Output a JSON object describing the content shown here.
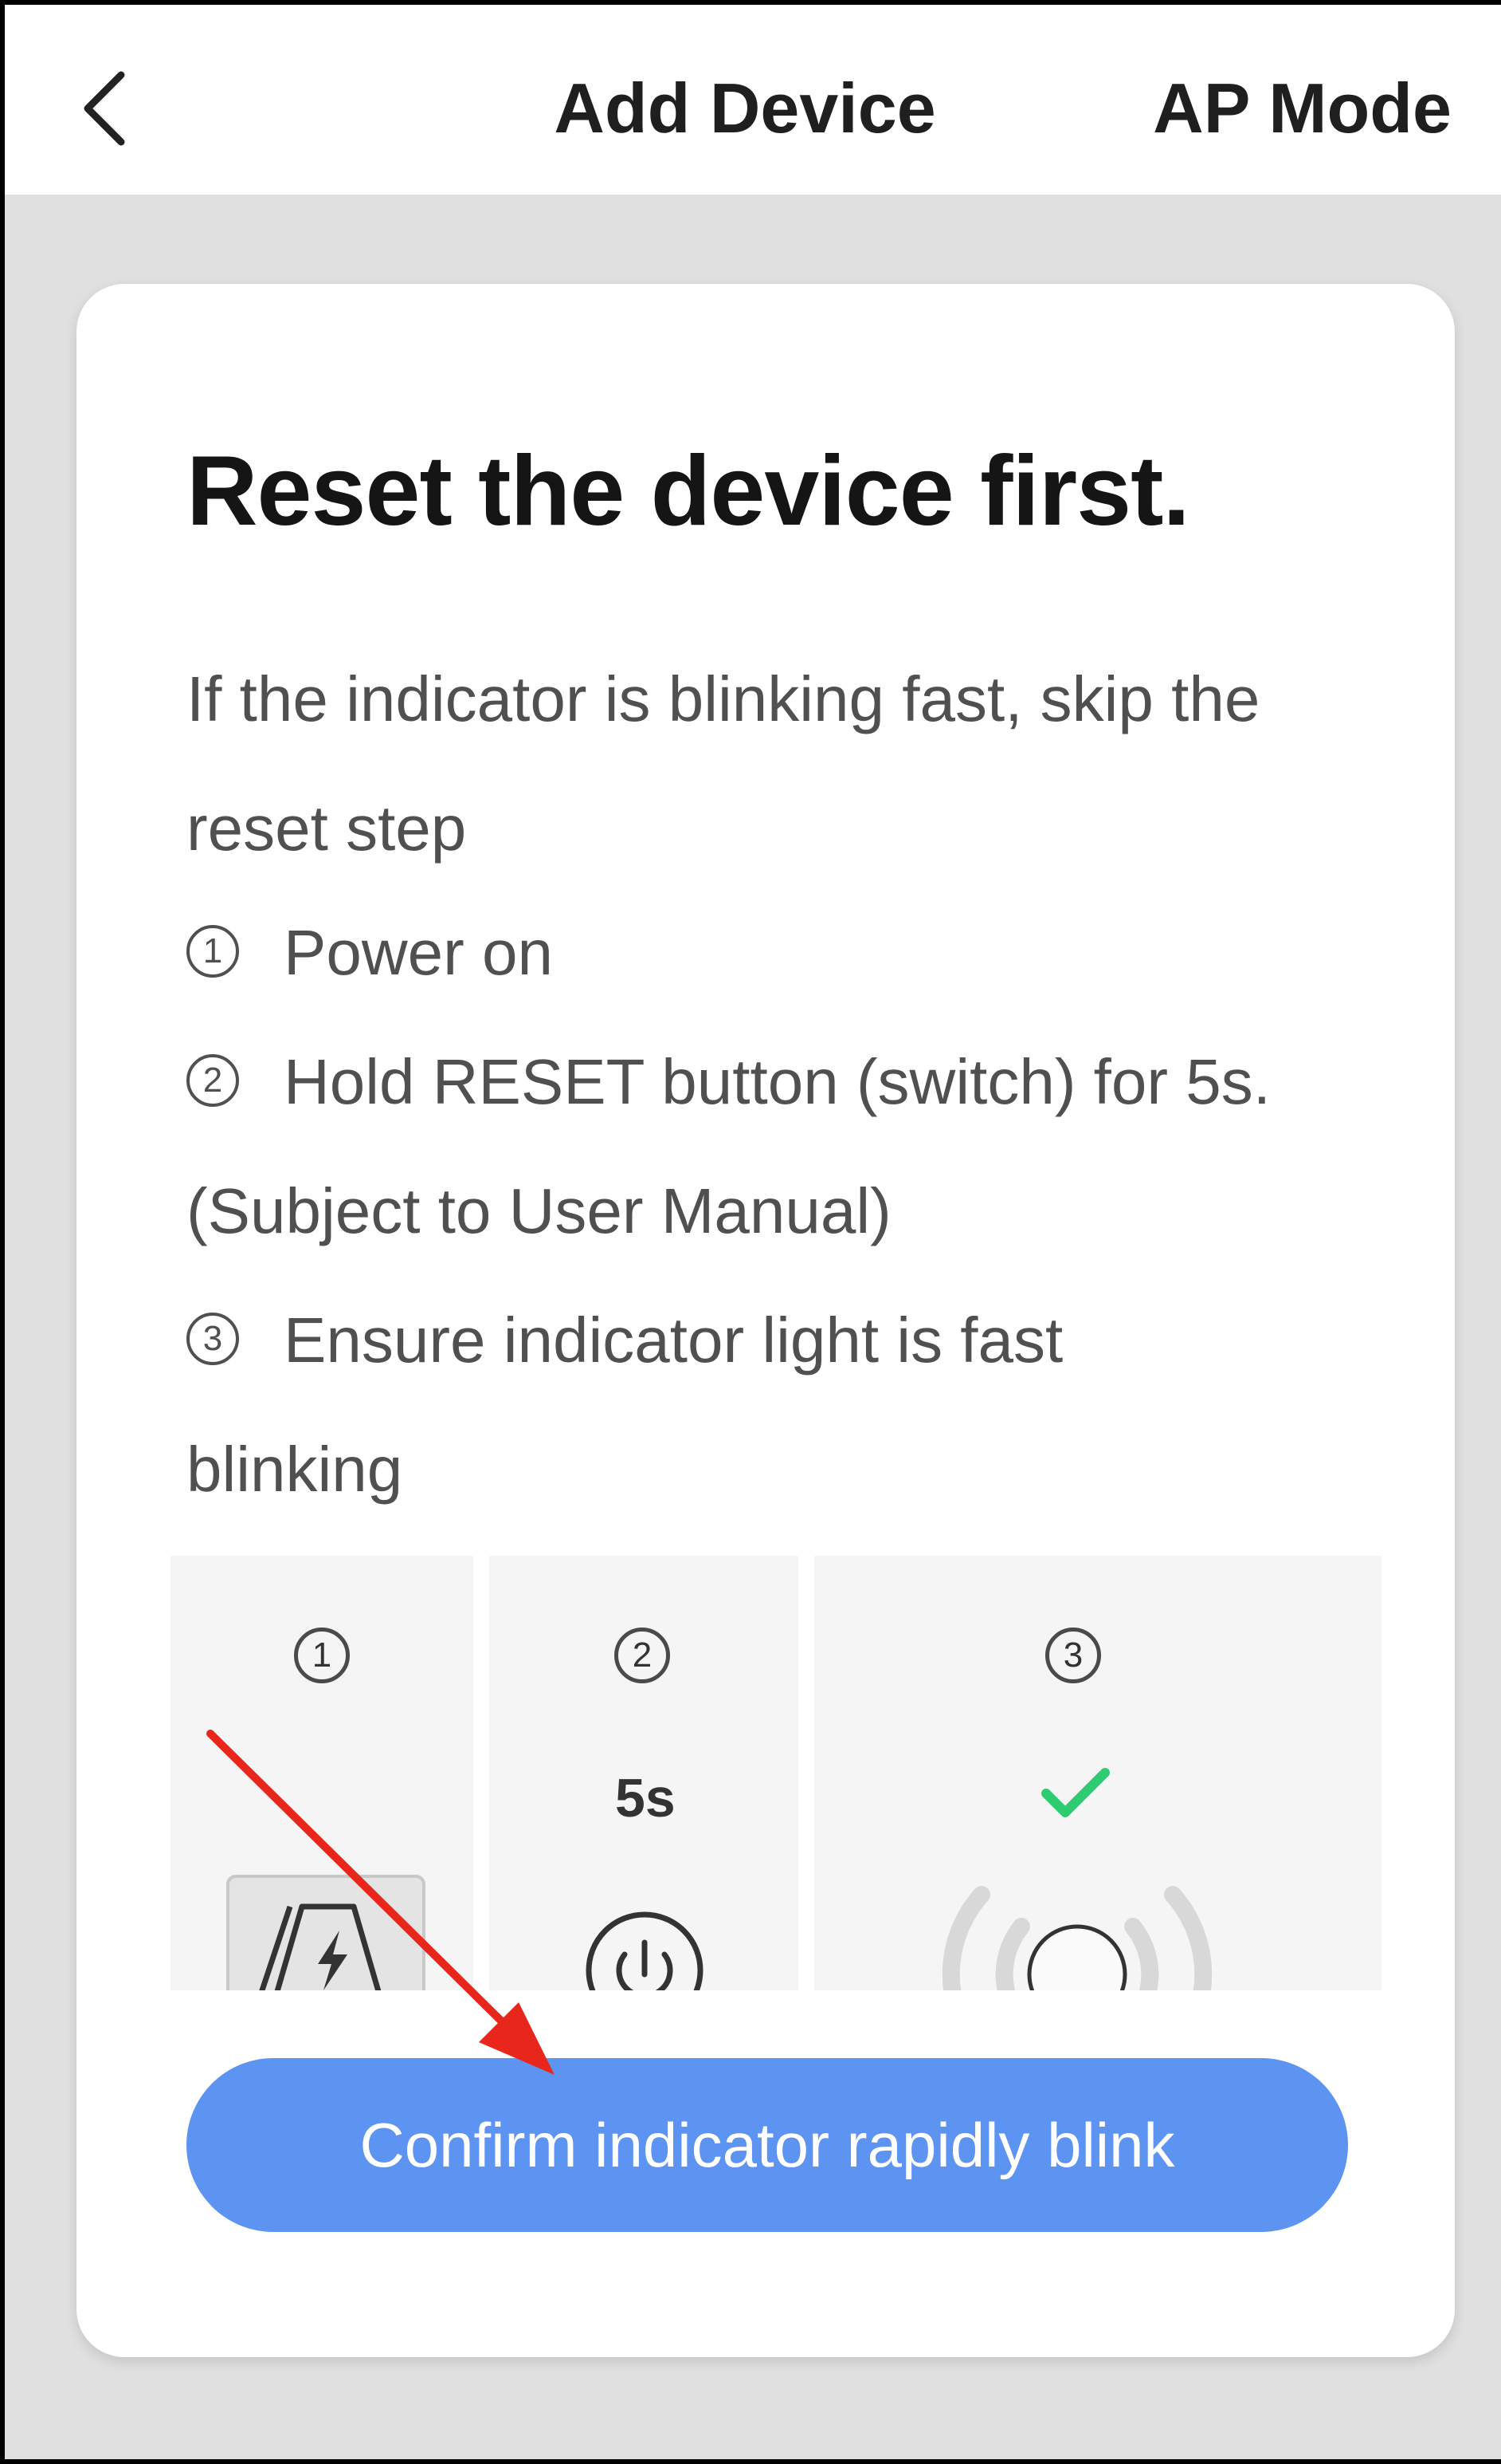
{
  "header": {
    "back_icon": "chevron-left-icon",
    "title": "Add Device",
    "ap_mode_label": "AP Mode"
  },
  "card": {
    "title": "Reset the device first.",
    "description": "If the indicator is blinking fast, skip the reset step",
    "steps": [
      {
        "num": "1",
        "text": "Power on"
      },
      {
        "num": "2",
        "text": "Hold RESET button (switch) for 5s.",
        "continuation": "(Subject to User Manual)"
      },
      {
        "num": "3",
        "text": "Ensure indicator light is fast",
        "continuation": "blinking"
      }
    ],
    "illustration": {
      "panels": [
        {
          "num": "1",
          "icon": "power-plug-icon"
        },
        {
          "num": "2",
          "label": "5s",
          "icon": "power-button-icon"
        },
        {
          "num": "3",
          "icon": "blinking-indicator-icon",
          "check_icon": "checkmark-icon"
        }
      ]
    },
    "confirm_button": "Confirm indicator rapidly blink"
  },
  "colors": {
    "accent": "#5d94f2",
    "check": "#2ecc71",
    "annotation_arrow": "#e8261c",
    "background": "#e0e0e0"
  }
}
